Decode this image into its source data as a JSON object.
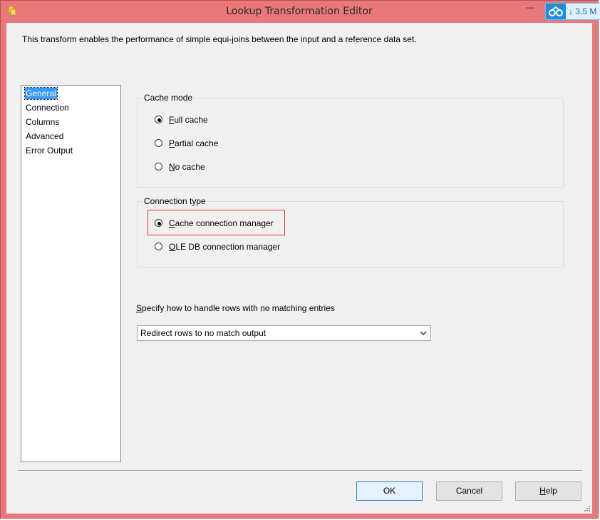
{
  "window": {
    "title": "Lookup Transformation Editor"
  },
  "badge": {
    "text": "↓ 3.5 M"
  },
  "description": "This transform enables the performance of simple equi-joins between the input and a reference data set.",
  "nav": {
    "items": [
      {
        "label": "General",
        "selected": true
      },
      {
        "label": "Connection",
        "selected": false
      },
      {
        "label": "Columns",
        "selected": false
      },
      {
        "label": "Advanced",
        "selected": false
      },
      {
        "label": "Error Output",
        "selected": false
      }
    ]
  },
  "cache_mode": {
    "title": "Cache mode",
    "options": [
      {
        "key": "F",
        "rest": "ull cache",
        "selected": true
      },
      {
        "key": "P",
        "rest": "artial cache",
        "selected": false
      },
      {
        "key": "N",
        "rest": "o cache",
        "selected": false
      }
    ]
  },
  "connection_type": {
    "title": "Connection type",
    "options": [
      {
        "key": "C",
        "rest": "ache connection manager",
        "selected": true
      },
      {
        "key": "O",
        "rest": "LE DB connection manager",
        "selected": false
      }
    ]
  },
  "no_match": {
    "label_key": "S",
    "label_rest": "pecify how to handle rows with no matching entries",
    "selected_value": "Redirect rows to no match output"
  },
  "buttons": {
    "ok": "OK",
    "cancel": "Cancel",
    "help_key": "H",
    "help_rest": "elp"
  },
  "colors": {
    "window_frame": "#e8787a",
    "selection": "#3399ff",
    "highlight_box": "#e03030"
  }
}
